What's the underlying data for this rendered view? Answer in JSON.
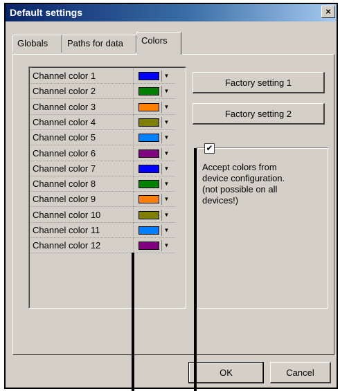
{
  "window": {
    "title": "Default settings",
    "close_glyph": "×"
  },
  "tabs": [
    {
      "label": "Globals",
      "active": false
    },
    {
      "label": "Paths for data",
      "active": false
    },
    {
      "label": "Colors",
      "active": true
    }
  ],
  "channel_colors": [
    {
      "label": "Channel color 1",
      "color": "#0000ff"
    },
    {
      "label": "Channel color 2",
      "color": "#008000"
    },
    {
      "label": "Channel color 3",
      "color": "#ff8000"
    },
    {
      "label": "Channel color 4",
      "color": "#808000"
    },
    {
      "label": "Channel color 5",
      "color": "#0080ff"
    },
    {
      "label": "Channel color 6",
      "color": "#800080"
    },
    {
      "label": "Channel color 7",
      "color": "#0000ff"
    },
    {
      "label": "Channel color 8",
      "color": "#008000"
    },
    {
      "label": "Channel color 9",
      "color": "#ff8000"
    },
    {
      "label": "Channel color 10",
      "color": "#808000"
    },
    {
      "label": "Channel color 11",
      "color": "#0080ff"
    },
    {
      "label": "Channel color 12",
      "color": "#800080"
    }
  ],
  "buttons": {
    "factory1": "Factory setting 1",
    "factory2": "Factory setting 2",
    "ok": "OK",
    "cancel": "Cancel"
  },
  "accept_colors": {
    "checked": true,
    "check_glyph": "✔",
    "text": "Accept colors from\ndevice configuration.\n(not possible on all\ndevices!)"
  },
  "dropdown_glyph": "▼"
}
